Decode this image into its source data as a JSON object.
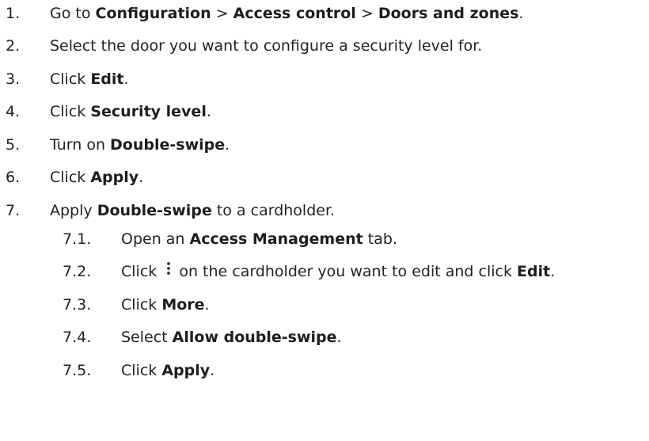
{
  "steps": [
    {
      "num": "1.",
      "pre": "Go to ",
      "b1": "Configuration",
      "sep1": " > ",
      "b2": "Access control",
      "sep2": " > ",
      "b3": "Doors and zones",
      "post": "."
    },
    {
      "num": "2.",
      "text": "Select the door you want to configure a security level for."
    },
    {
      "num": "3.",
      "pre": "Click ",
      "bold": "Edit",
      "post": "."
    },
    {
      "num": "4.",
      "pre": "Click ",
      "bold": "Security level",
      "post": "."
    },
    {
      "num": "5.",
      "pre": "Turn on ",
      "bold": "Double-swipe",
      "post": "."
    },
    {
      "num": "6.",
      "pre": "Click ",
      "bold": "Apply",
      "post": "."
    },
    {
      "num": "7.",
      "pre": "Apply ",
      "bold": "Double-swipe",
      "post": " to a cardholder."
    }
  ],
  "substeps": [
    {
      "num": "7.1.",
      "pre": "Open an ",
      "bold": "Access Management",
      "post": " tab."
    },
    {
      "num": "7.2.",
      "pre": "Click ",
      "icon": "kebab-menu-icon",
      "mid": "on the cardholder you want to edit and click ",
      "bold": "Edit",
      "post": "."
    },
    {
      "num": "7.3.",
      "pre": "Click ",
      "bold": "More",
      "post": "."
    },
    {
      "num": "7.4.",
      "pre": "Select ",
      "bold": "Allow double-swipe",
      "post": "."
    },
    {
      "num": "7.5.",
      "pre": "Click ",
      "bold": "Apply",
      "post": "."
    }
  ],
  "colors": {
    "text": "#222222",
    "background": "#ffffff"
  }
}
